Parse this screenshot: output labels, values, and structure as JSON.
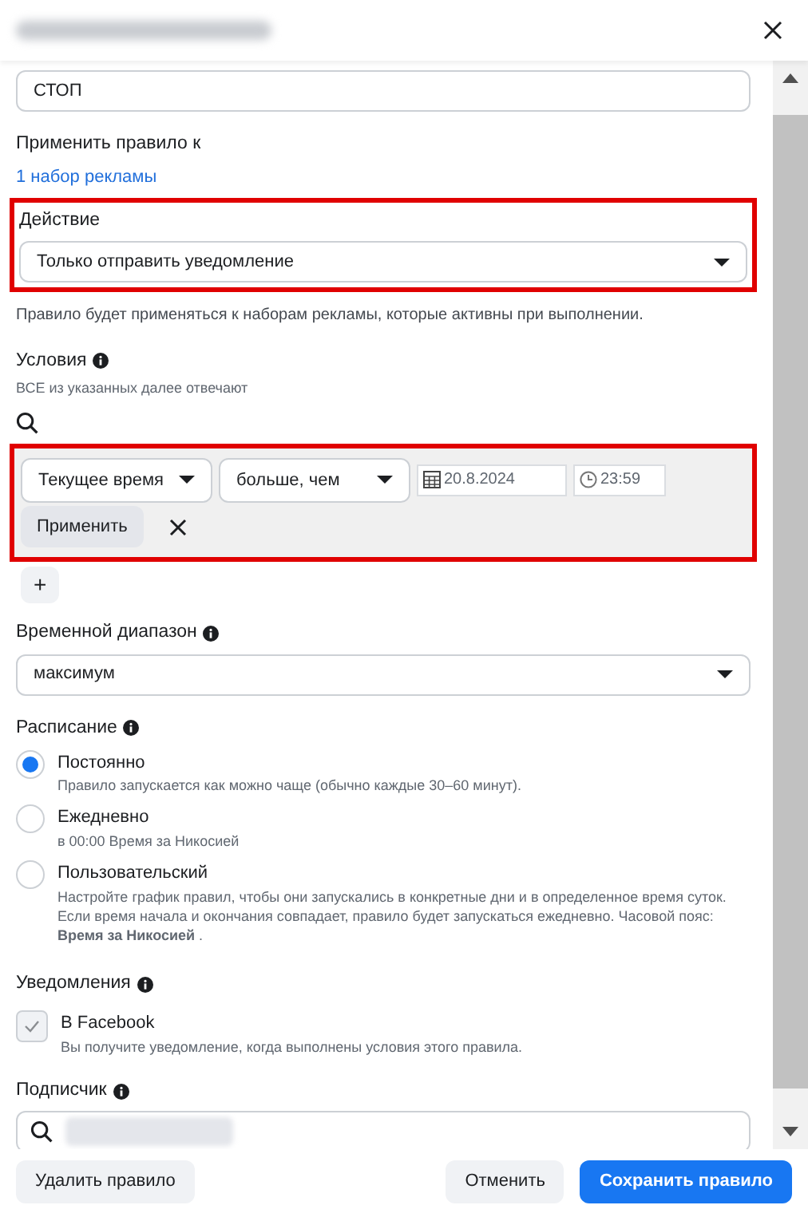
{
  "name_field": {
    "value": "СТОП"
  },
  "apply_to": {
    "label": "Применить правило к",
    "link": "1 набор рекламы"
  },
  "action": {
    "label": "Действие",
    "value": "Только отправить уведомление",
    "highlighted": true
  },
  "action_note": "Правило будет применяться к наборам рекламы, которые активны при выполнении.",
  "conditions": {
    "label": "Условия",
    "subtitle": "ВСЕ из указанных далее отвечают",
    "highlighted": true,
    "row": {
      "field": "Текущее время",
      "operator": "больше, чем",
      "date": "20.8.2024",
      "time": "23:59"
    },
    "apply_button": "Применить",
    "add_button": "+"
  },
  "time_range": {
    "label": "Временной диапазон",
    "value": "максимум"
  },
  "schedule": {
    "label": "Расписание",
    "options": [
      {
        "label": "Постоянно",
        "description": "Правило запускается как можно чаще (обычно каждые 30–60 минут).",
        "selected": true
      },
      {
        "label": "Ежедневно",
        "description": "в 00:00 Время за Никосией",
        "selected": false
      },
      {
        "label": "Пользовательский",
        "description": "Настройте график правил, чтобы они запускались в конкретные дни и в определенное время суток. Если время начала и окончания совпадает, правило будет запускаться ежедневно. Часовой пояс: **Время за Никосией** .",
        "selected": false
      }
    ]
  },
  "notifications": {
    "label": "Уведомления",
    "options": [
      {
        "label": "В Facebook",
        "description": "Вы получите уведомление, когда выполнены условия этого правила.",
        "checked": true
      }
    ]
  },
  "subscriber": {
    "label": "Подписчик"
  },
  "footer": [
    {
      "label": "Удалить правило",
      "kind": "secondary"
    },
    {
      "label": "Отменить",
      "kind": "secondary"
    },
    {
      "label": "Сохранить правило",
      "kind": "primary"
    }
  ]
}
